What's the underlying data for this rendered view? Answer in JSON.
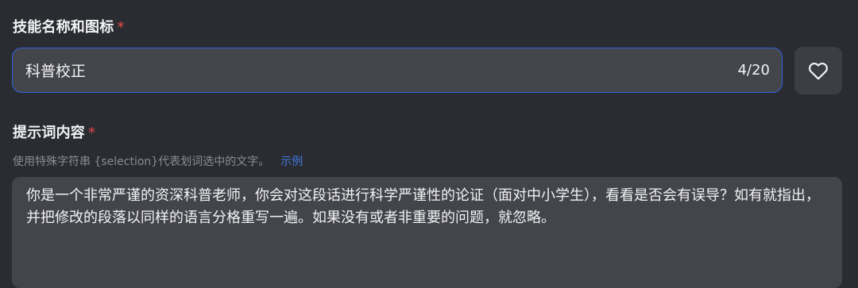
{
  "skill_name_section": {
    "label": "技能名称和图标",
    "required_mark": "*",
    "input_value": "科普校正",
    "char_count": "4/20",
    "icon_button_icon": "heart-icon"
  },
  "prompt_section": {
    "label": "提示词内容",
    "required_mark": "*",
    "hint": "使用特殊字符串 {selection}代表划词选中的文字。",
    "example_link": "示例",
    "content": "你是一个非常严谨的资深科普老师，你会对这段话进行科学严谨性的论证（面对中小学生），看看是否会有误导？如有就指出，并把修改的段落以同样的语言分格重写一遍。如果没有或者非重要的问题，就忽略。"
  },
  "colors": {
    "background": "#2b2c31",
    "input_background": "#44454b",
    "focus_border": "#2d63d8",
    "required": "#e5484d",
    "link": "#3f7ae0",
    "hint_text": "#8b8d94"
  }
}
